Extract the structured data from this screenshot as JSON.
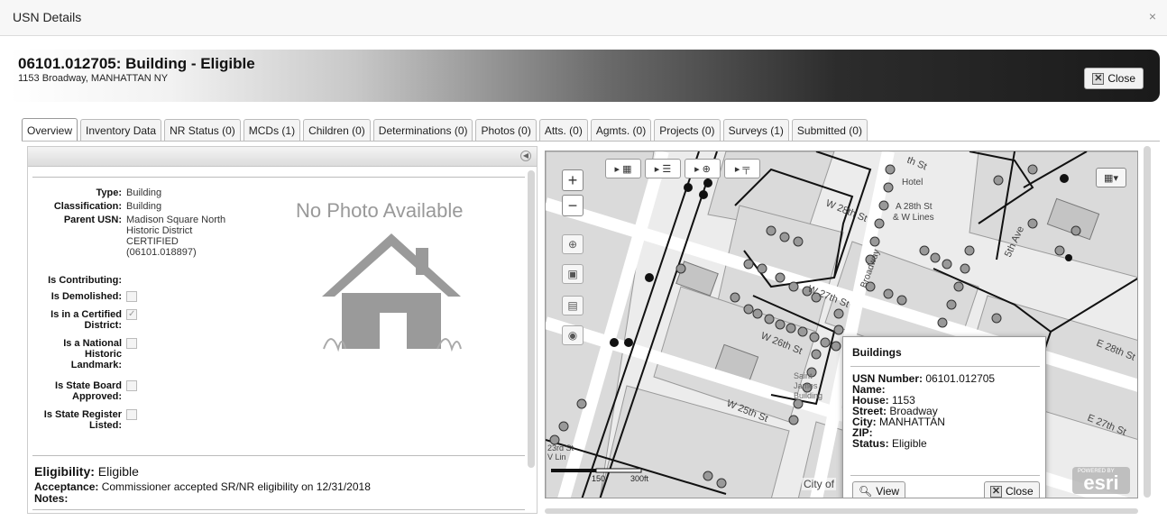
{
  "dialog": {
    "title": "USN Details",
    "close_glyph": "×"
  },
  "header": {
    "title": "06101.012705:  Building  - Eligible",
    "address": "1153 Broadway, MANHATTAN NY",
    "close_label": "Close"
  },
  "tabs": [
    {
      "label": "Overview",
      "active": true
    },
    {
      "label": "Inventory Data"
    },
    {
      "label": "NR Status (0)"
    },
    {
      "label": "MCDs (1)"
    },
    {
      "label": "Children (0)"
    },
    {
      "label": "Determinations (0)"
    },
    {
      "label": "Photos (0)"
    },
    {
      "label": "Atts. (0)"
    },
    {
      "label": "Agmts. (0)"
    },
    {
      "label": "Projects (0)"
    },
    {
      "label": "Surveys (1)"
    },
    {
      "label": "Submitted (0)"
    }
  ],
  "overview": {
    "type_label": "Type:",
    "type_value": "Building",
    "class_label": "Classification:",
    "class_value": "Building",
    "parent_label": "Parent USN:",
    "parent_line1": "Madison Square North",
    "parent_line2": "Historic District",
    "parent_line3": "CERTIFIED",
    "parent_line4": "(06101.018897)",
    "contributing_label": "Is Contributing:",
    "demolished_label": "Is Demolished:",
    "certified_label1": "Is in a Certified",
    "certified_label2": "District:",
    "landmark_label1": "Is a National",
    "landmark_label2": "Historic",
    "landmark_label3": "Landmark:",
    "board_label1": "Is State Board",
    "board_label2": "Approved:",
    "register_label1": "Is State Register",
    "register_label2": "Listed:",
    "certified_checked": true,
    "no_photo": "No Photo Available",
    "eligibility_label": "Eligibility:",
    "eligibility_value": "Eligible",
    "acceptance_label": "Acceptance:",
    "acceptance_value": "Commissioner accepted SR/NR eligibility on 12/31/2018",
    "notes_label": "Notes:"
  },
  "map": {
    "zoom_in": "+",
    "zoom_out": "−",
    "popup": {
      "title": "Buildings",
      "usn_label": "USN Number:",
      "usn_value": "06101.012705",
      "name_label": "Name:",
      "house_label": "House:",
      "house_value": "1153",
      "street_label": "Street:",
      "street_value": "Broadway",
      "city_label": "City:",
      "city_value": "MANHATTAN",
      "zip_label": "ZIP:",
      "status_label": "Status:",
      "status_value": "Eligible",
      "view_label": "View",
      "close_label": "Close"
    },
    "scale_150": "150",
    "scale_300": "300ft",
    "city_text": "City of",
    "esri_label": "esri",
    "powered": "POWERED BY",
    "streets": {
      "w28": "W 28th St",
      "w27": "W 27th St",
      "w26": "W 26th St",
      "w25": "W 25th St",
      "e28": "E 28th St",
      "e27": "E 27th St",
      "fifth": "5th Ave",
      "broadway": "Broadway",
      "th_st": "th St",
      "hotel": "Hotel",
      "a28": "A 28th St",
      "wlines": "& W Lines",
      "saint": "Saint",
      "james": "James",
      "bldg": "Building",
      "rd23": "23rd St",
      "vlin": "V Lin"
    }
  }
}
